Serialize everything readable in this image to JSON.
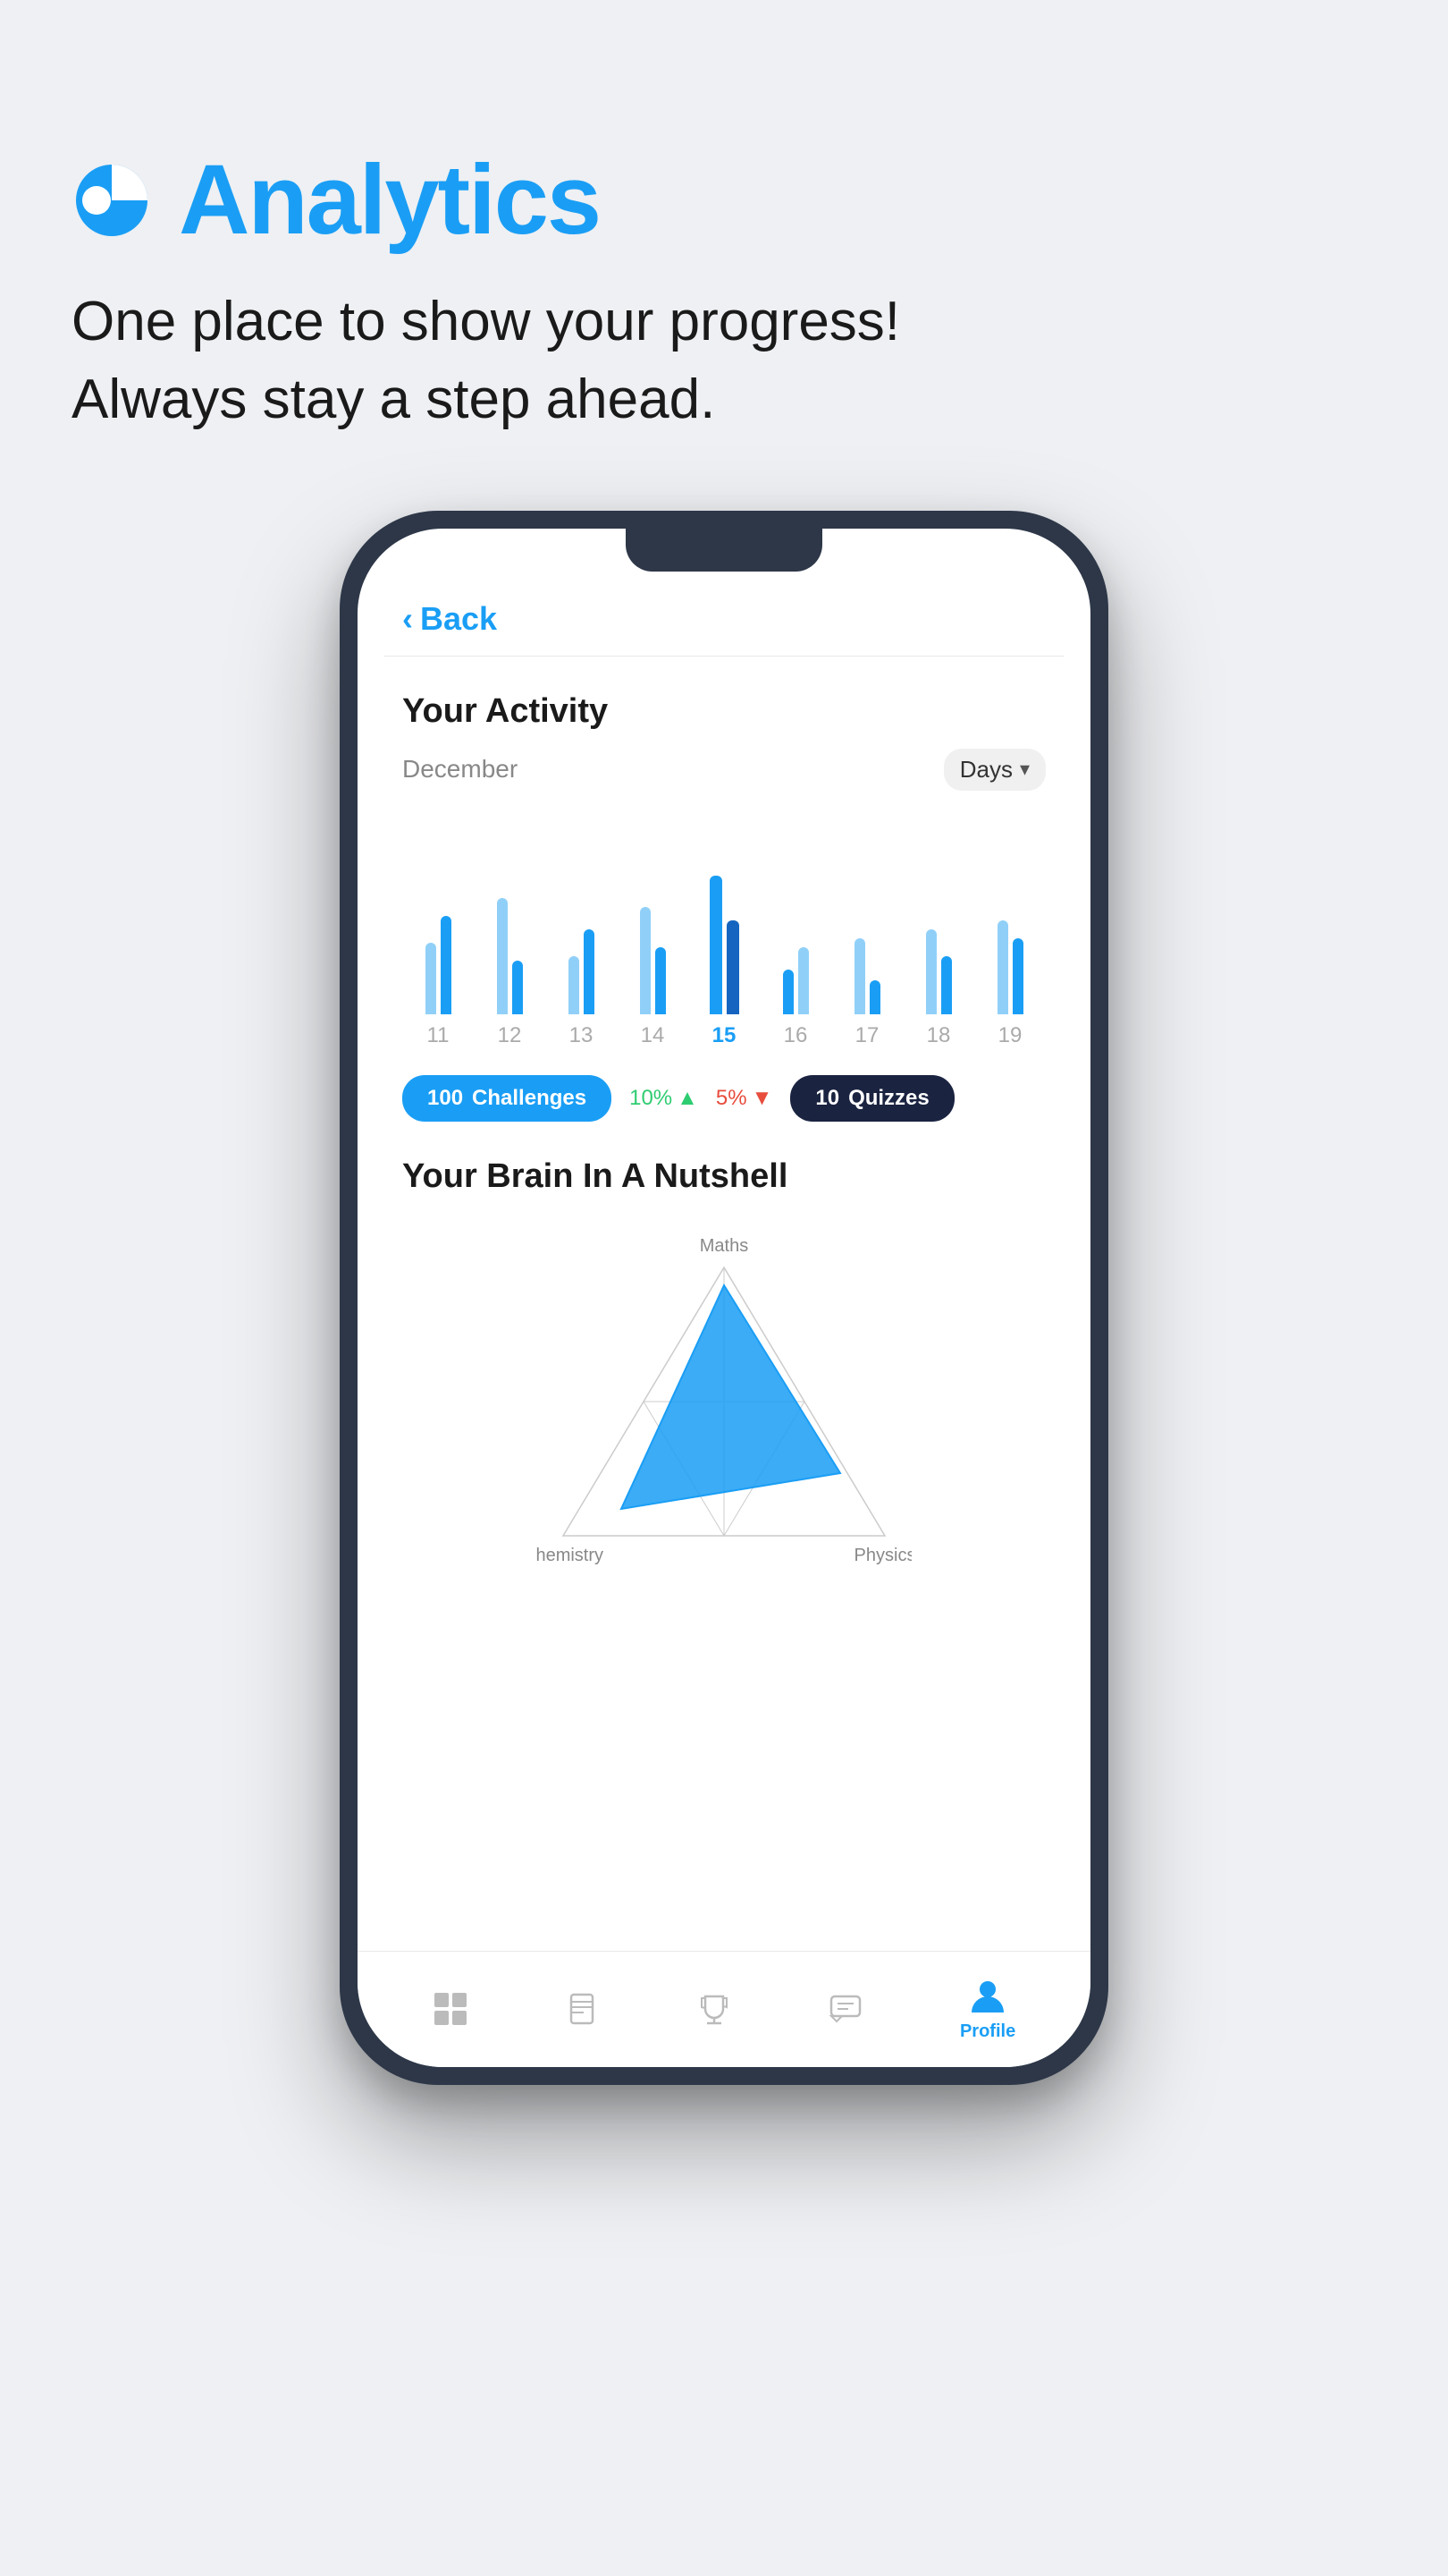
{
  "header": {
    "icon_label": "analytics-icon",
    "title": "Analytics",
    "subtitle_line1": "One place to show your progress!",
    "subtitle_line2": "Always stay a step ahead."
  },
  "phone": {
    "back_button": "Back",
    "screen": {
      "activity": {
        "title": "Your Activity",
        "month": "December",
        "period_selector": "Days",
        "bars": [
          {
            "day": "11",
            "heights": [
              80,
              120
            ],
            "active": false
          },
          {
            "day": "12",
            "heights": [
              140,
              60
            ],
            "active": false
          },
          {
            "day": "13",
            "heights": [
              70,
              100
            ],
            "active": false
          },
          {
            "day": "14",
            "heights": [
              130,
              80
            ],
            "active": false
          },
          {
            "day": "15",
            "heights": [
              160,
              110
            ],
            "active": true
          },
          {
            "day": "16",
            "heights": [
              50,
              80
            ],
            "active": false
          },
          {
            "day": "17",
            "heights": [
              90,
              40
            ],
            "active": false
          },
          {
            "day": "18",
            "heights": [
              100,
              70
            ],
            "active": false
          },
          {
            "day": "19",
            "heights": [
              110,
              90
            ],
            "active": false
          }
        ],
        "stats": {
          "challenges": {
            "count": 100,
            "label": "Challenges"
          },
          "change_green": {
            "value": "10%",
            "direction": "up"
          },
          "change_red": {
            "value": "5%",
            "direction": "down"
          },
          "quizzes": {
            "count": 10,
            "label": "Quizzes"
          }
        }
      },
      "nutshell": {
        "title": "Your Brain In A Nutshell",
        "labels": {
          "top": "Maths",
          "bottom_left": "Chemistry",
          "bottom_right": "Physics"
        }
      }
    },
    "bottom_nav": [
      {
        "icon": "grid-icon",
        "label": "",
        "active": false
      },
      {
        "icon": "book-icon",
        "label": "",
        "active": false
      },
      {
        "icon": "trophy-icon",
        "label": "",
        "active": false
      },
      {
        "icon": "chat-icon",
        "label": "",
        "active": false
      },
      {
        "icon": "profile-icon",
        "label": "Profile",
        "active": true
      }
    ]
  },
  "colors": {
    "accent": "#1a9ef5",
    "background": "#eef0f3",
    "phone_body": "#2d3748"
  }
}
